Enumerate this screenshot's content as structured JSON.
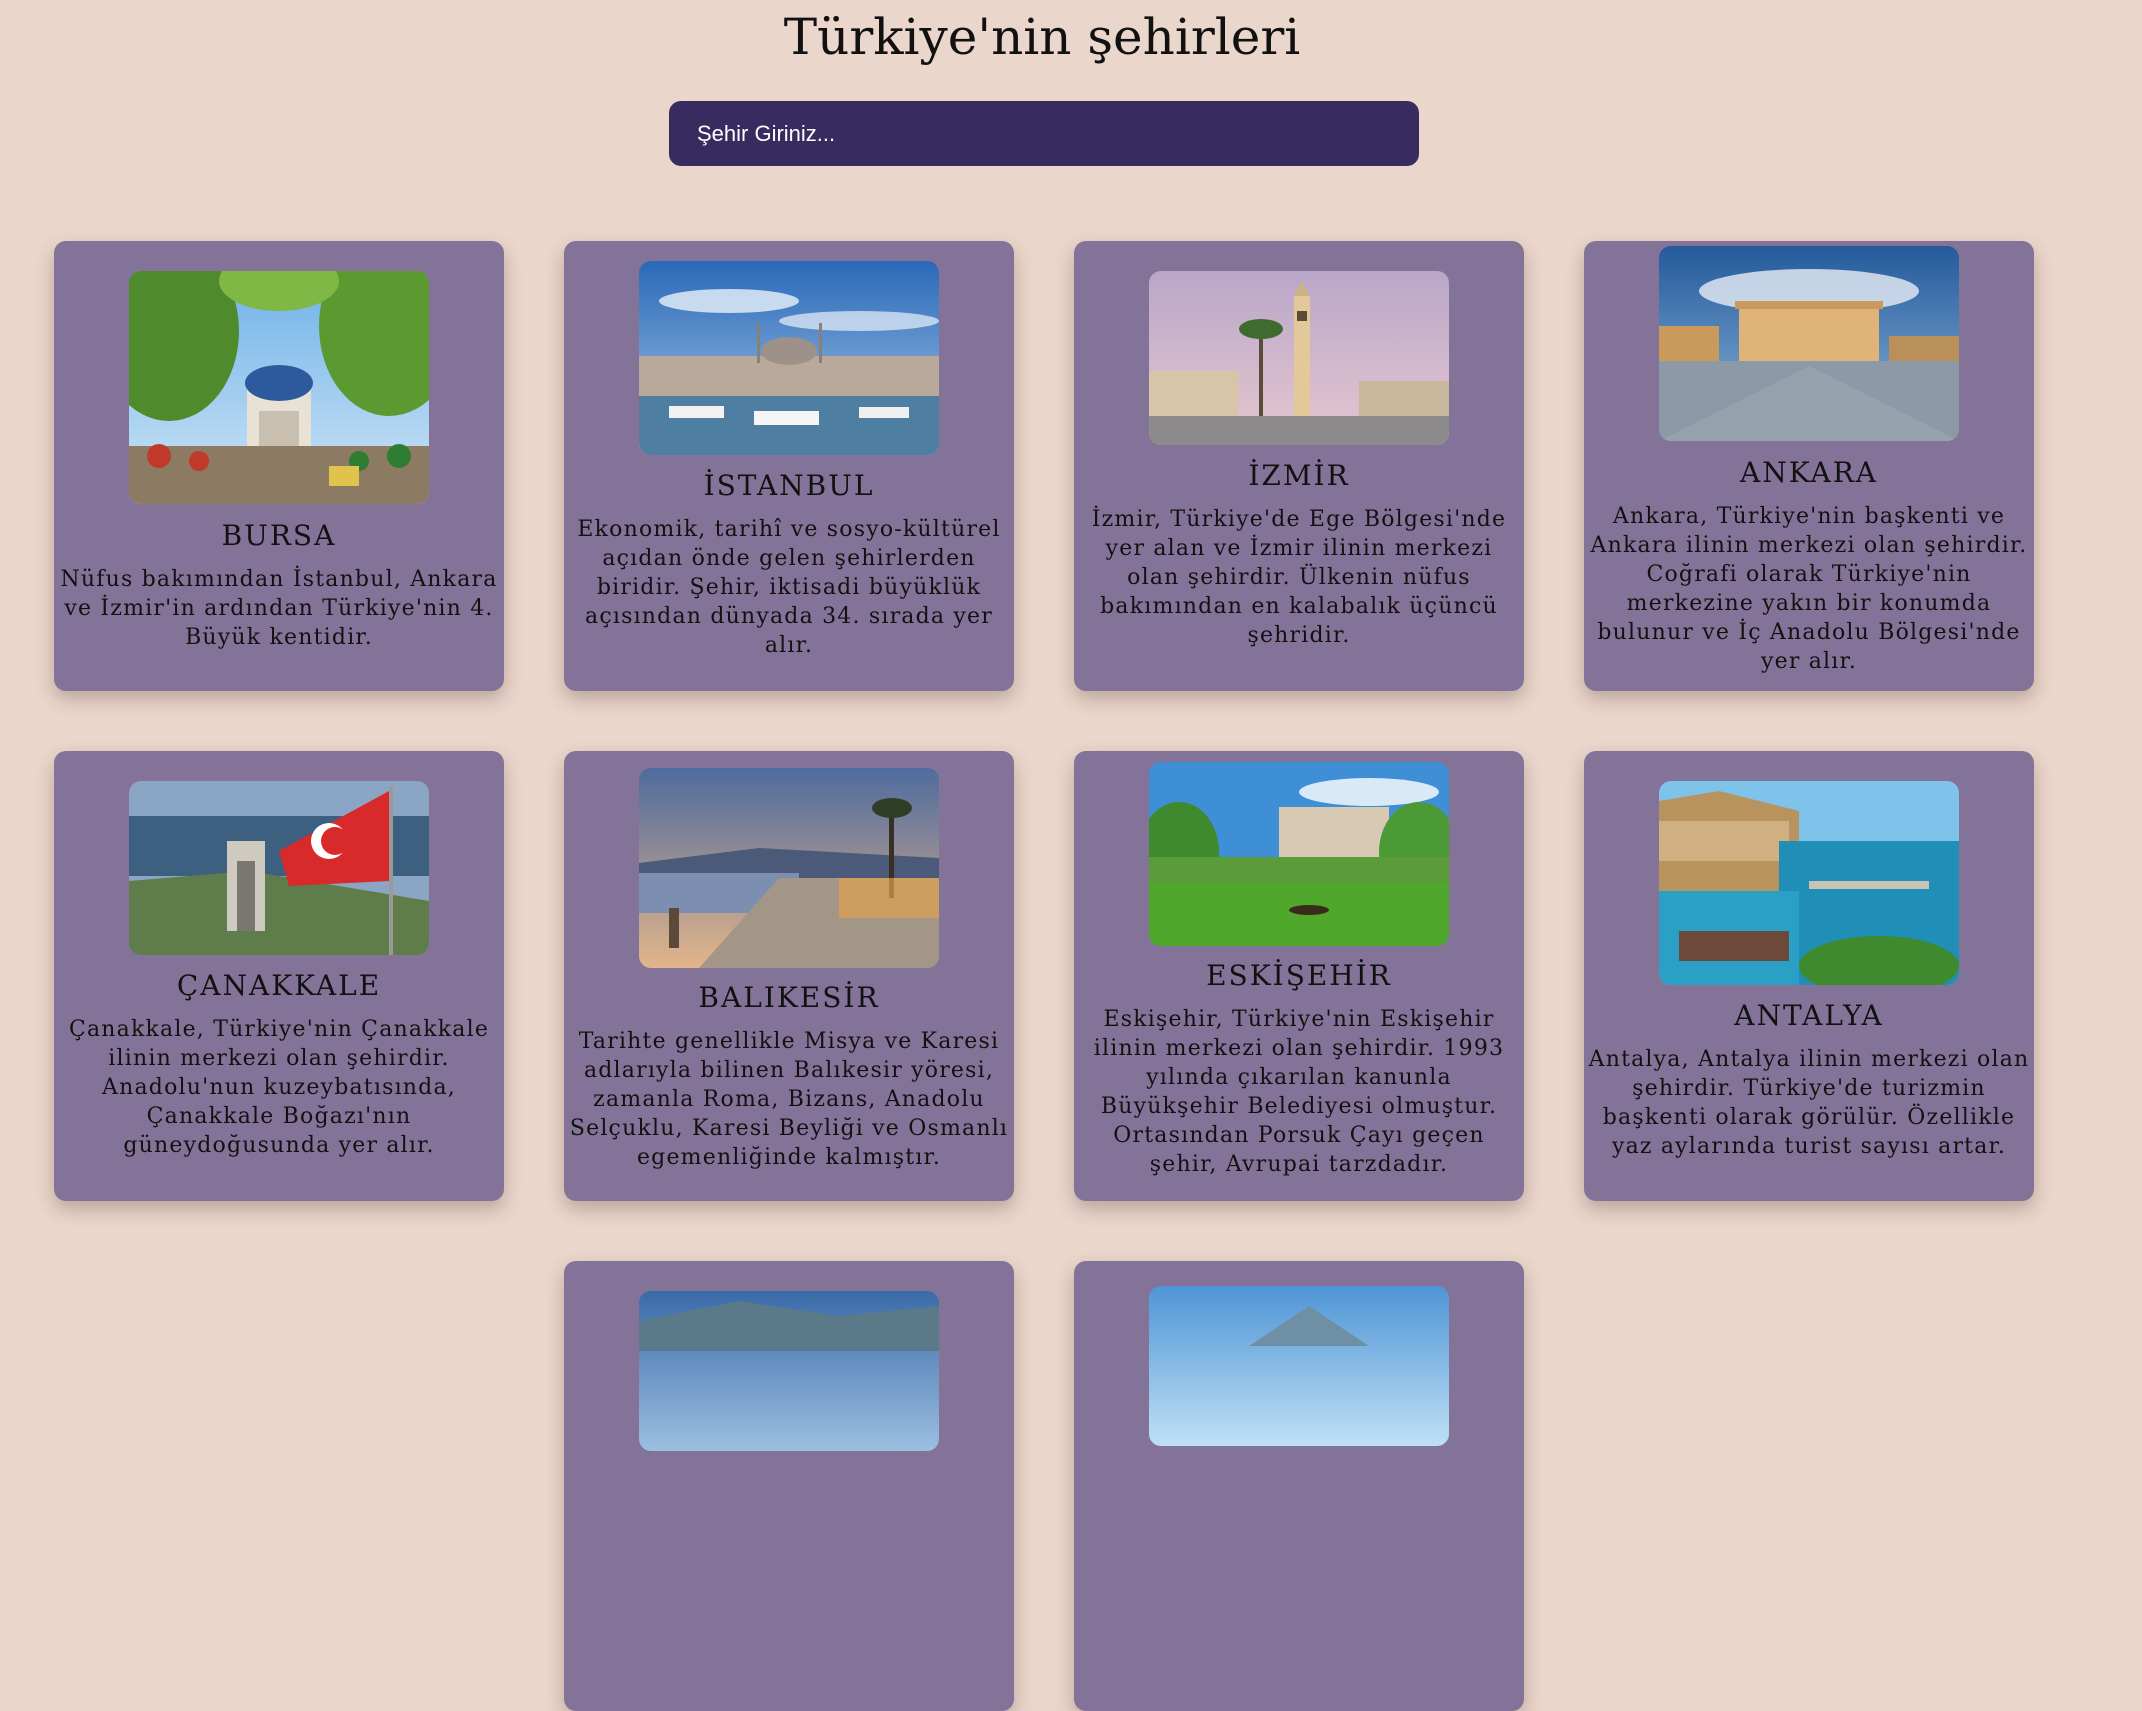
{
  "page": {
    "title": "Türkiye'nin şehirleri"
  },
  "search": {
    "placeholder": "Şehir Giriniz..."
  },
  "cities": [
    {
      "name": "BURSA",
      "description": "Nüfus bakımından İstanbul, Ankara ve İzmir'in ardından Türkiye'nin 4. Büyük kentidir."
    },
    {
      "name": "İSTANBUL",
      "description": "Ekonomik, tarihî ve sosyo-kültürel açıdan önde gelen şehirlerden biridir. Şehir, iktisadi büyüklük açısından dünyada 34. sırada yer alır."
    },
    {
      "name": "İZMİR",
      "description": "İzmir, Türkiye'de Ege Bölgesi'nde yer alan ve İzmir ilinin merkezi olan şehirdir. Ülkenin nüfus bakımından en kalabalık üçüncü şehridir."
    },
    {
      "name": "ANKARA",
      "description": "Ankara, Türkiye'nin başkenti ve Ankara ilinin merkezi olan şehirdir. Coğrafi olarak Türkiye'nin merkezine yakın bir konumda bulunur ve İç Anadolu Bölgesi'nde yer alır."
    },
    {
      "name": "ÇANAKKALE",
      "description": "Çanakkale, Türkiye'nin Çanakkale ilinin merkezi olan şehirdir. Anadolu'nun kuzeybatısında, Çanakkale Boğazı'nın güneydoğusunda yer alır."
    },
    {
      "name": "BALIKESİR",
      "description": "Tarihte genellikle Misya ve Karesi adlarıyla bilinen Balıkesir yöresi, zamanla Roma, Bizans, Anadolu Selçuklu, Karesi Beyliği ve Osmanlı egemenliğinde kalmıştır."
    },
    {
      "name": "ESKİŞEHİR",
      "description": "Eskişehir, Türkiye'nin Eskişehir ilinin merkezi olan şehirdir. 1993 yılında çıkarılan kanunla Büyükşehir Belediyesi olmuştur. Ortasından Porsuk Çayı geçen şehir, Avrupai tarzdadır."
    },
    {
      "name": "ANTALYA",
      "description": "Antalya, Antalya ilinin merkezi olan şehirdir. Türkiye'de turizmin başkenti olarak görülür. Özellikle yaz aylarında turist sayısı artar."
    }
  ],
  "colors": {
    "background": "#ebd6cb",
    "card": "#847398",
    "search": "#372b60"
  }
}
